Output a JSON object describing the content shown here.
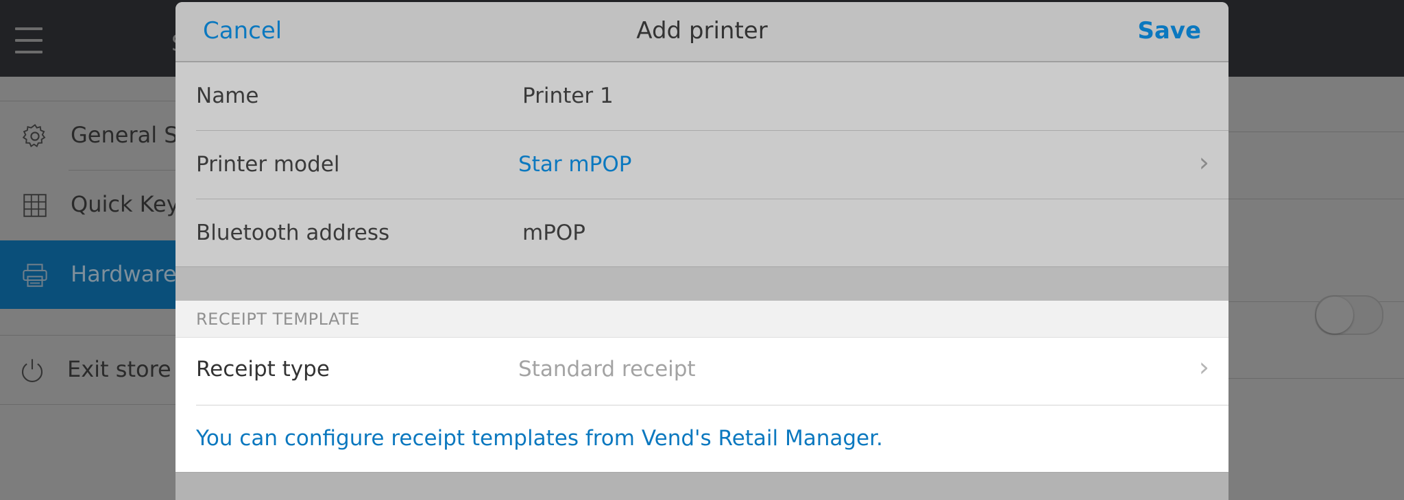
{
  "background": {
    "menu_icon": "hamburger-icon",
    "topbar_title": "S",
    "sidebar": [
      {
        "icon": "gear-icon",
        "label": "General Settings",
        "active": false
      },
      {
        "icon": "grid-icon",
        "label": "Quick Keys",
        "active": false
      },
      {
        "icon": "printer-icon",
        "label": "Hardware",
        "active": true
      },
      {
        "icon": "power-icon",
        "label": "Exit store",
        "active": false
      }
    ],
    "toggle_state": "off"
  },
  "modal": {
    "cancel_label": "Cancel",
    "title": "Add printer",
    "save_label": "Save",
    "fields": [
      {
        "label": "Name",
        "value": "Printer 1"
      },
      {
        "label": "Printer model",
        "value": "Star mPOP"
      },
      {
        "label": "Bluetooth address",
        "value": "mPOP"
      }
    ],
    "receipt_section": {
      "header": "RECEIPT TEMPLATE",
      "type_label": "Receipt type",
      "type_value": "Standard receipt",
      "note": "You can configure receipt templates from Vend's Retail Manager."
    },
    "chevron_icon": "chevron-right-icon",
    "colors": {
      "accent": "#0b78bf",
      "active_sidebar": "#0a4f7a"
    }
  }
}
